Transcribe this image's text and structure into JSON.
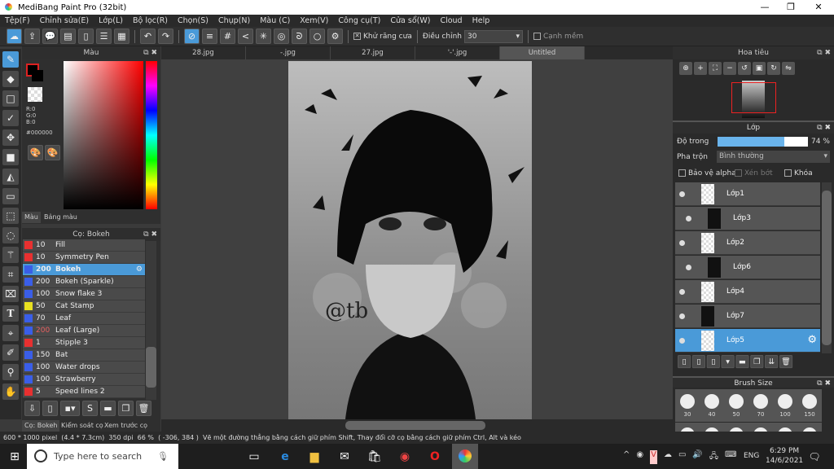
{
  "app": {
    "title": "MediBang Paint Pro (32bit)"
  },
  "menu": [
    "Tệp(F)",
    "Chỉnh sửa(E)",
    "Lớp(L)",
    "Bộ lọc(R)",
    "Chọn(S)",
    "Chụp(N)",
    "Màu (C)",
    "Xem(V)",
    "Công cụ(T)",
    "Cửa sổ(W)",
    "Cloud",
    "Help"
  ],
  "toolbar": {
    "antialias_label": "Khử răng cưa",
    "antialias_checked": true,
    "correction_label": "Điều chỉnh",
    "correction_value": "30",
    "soft_edge_label": "Cạnh mềm",
    "soft_edge_checked": false
  },
  "color_panel": {
    "title": "Màu",
    "r": "R:0",
    "g": "G:0",
    "b": "B:0",
    "hex": "#000000",
    "tabs": [
      "Màu",
      "Bảng màu"
    ],
    "fg_color": "#000000"
  },
  "brush_panel": {
    "title": "Cọ: Bokeh",
    "items": [
      {
        "size": "10",
        "name": "Fill",
        "color": "#e83030"
      },
      {
        "size": "10",
        "name": "Symmetry Pen",
        "color": "#e83030"
      },
      {
        "size": "200",
        "name": "Bokeh",
        "color": "#3a5ee8",
        "selected": true
      },
      {
        "size": "200",
        "name": "Bokeh (Sparkle)",
        "color": "#3a5ee8"
      },
      {
        "size": "100",
        "name": "Snow flake 3",
        "color": "#3a5ee8"
      },
      {
        "size": "50",
        "name": "Cat Stamp",
        "color": "#e8e020"
      },
      {
        "size": "70",
        "name": "Leaf",
        "color": "#3a5ee8"
      },
      {
        "size": "200",
        "name": "Leaf (Large)",
        "color": "#3a5ee8",
        "size_color": "#e86060"
      },
      {
        "size": "1",
        "name": "Stipple 3",
        "color": "#e83030"
      },
      {
        "size": "150",
        "name": "Bat",
        "color": "#3a5ee8"
      },
      {
        "size": "100",
        "name": "Water drops",
        "color": "#3a5ee8"
      },
      {
        "size": "100",
        "name": "Strawberry",
        "color": "#3a5ee8"
      },
      {
        "size": "5",
        "name": "Speed lines 2",
        "color": "#e83030"
      }
    ],
    "tabs": [
      "Cọ: Bokeh",
      "Kiểm soát cọ",
      "Xem trước cọ"
    ]
  },
  "doc_tabs": [
    "28.jpg",
    "-.jpg",
    "27.jpg",
    "'-'.jpg",
    "Untitled"
  ],
  "canvas": {
    "signature": "@tb"
  },
  "navigator": {
    "title": "Hoa tiêu"
  },
  "layer_panel": {
    "title": "Lớp",
    "opacity_label": "Độ trong",
    "opacity_value": "74 %",
    "opacity_percent": 74,
    "blend_label": "Pha trộn",
    "blend_value": "Bình thường",
    "protect_alpha": "Bảo vệ alpha",
    "clipping": "Xén bớt",
    "lock": "Khóa",
    "layers": [
      {
        "name": "Lớp1",
        "indent": false
      },
      {
        "name": "Lớp3",
        "indent": true
      },
      {
        "name": "Lớp2",
        "indent": false
      },
      {
        "name": "Lớp6",
        "indent": true
      },
      {
        "name": "Lớp4",
        "indent": false
      },
      {
        "name": "Lớp7",
        "indent": false
      },
      {
        "name": "Lớp5",
        "indent": false,
        "selected": true
      }
    ]
  },
  "brush_size": {
    "title": "Brush Size",
    "sizes": [
      "30",
      "40",
      "50",
      "70",
      "100",
      "150"
    ]
  },
  "status": {
    "dimensions": "600 * 1000 pixel",
    "physical": "(4.4 * 7.3cm)",
    "dpi": "350 dpi",
    "zoom": "66 %",
    "coords": "( -306, 384 )",
    "hint": "Vẽ một đường thẳng bằng cách giữ phím Shift, Thay đổi cỡ cọ bằng cách giữ phím Ctrl, Alt và kéo"
  },
  "taskbar": {
    "search_placeholder": "Type here to search",
    "language": "ENG",
    "time": "6:29 PM",
    "date": "14/6/2021"
  }
}
